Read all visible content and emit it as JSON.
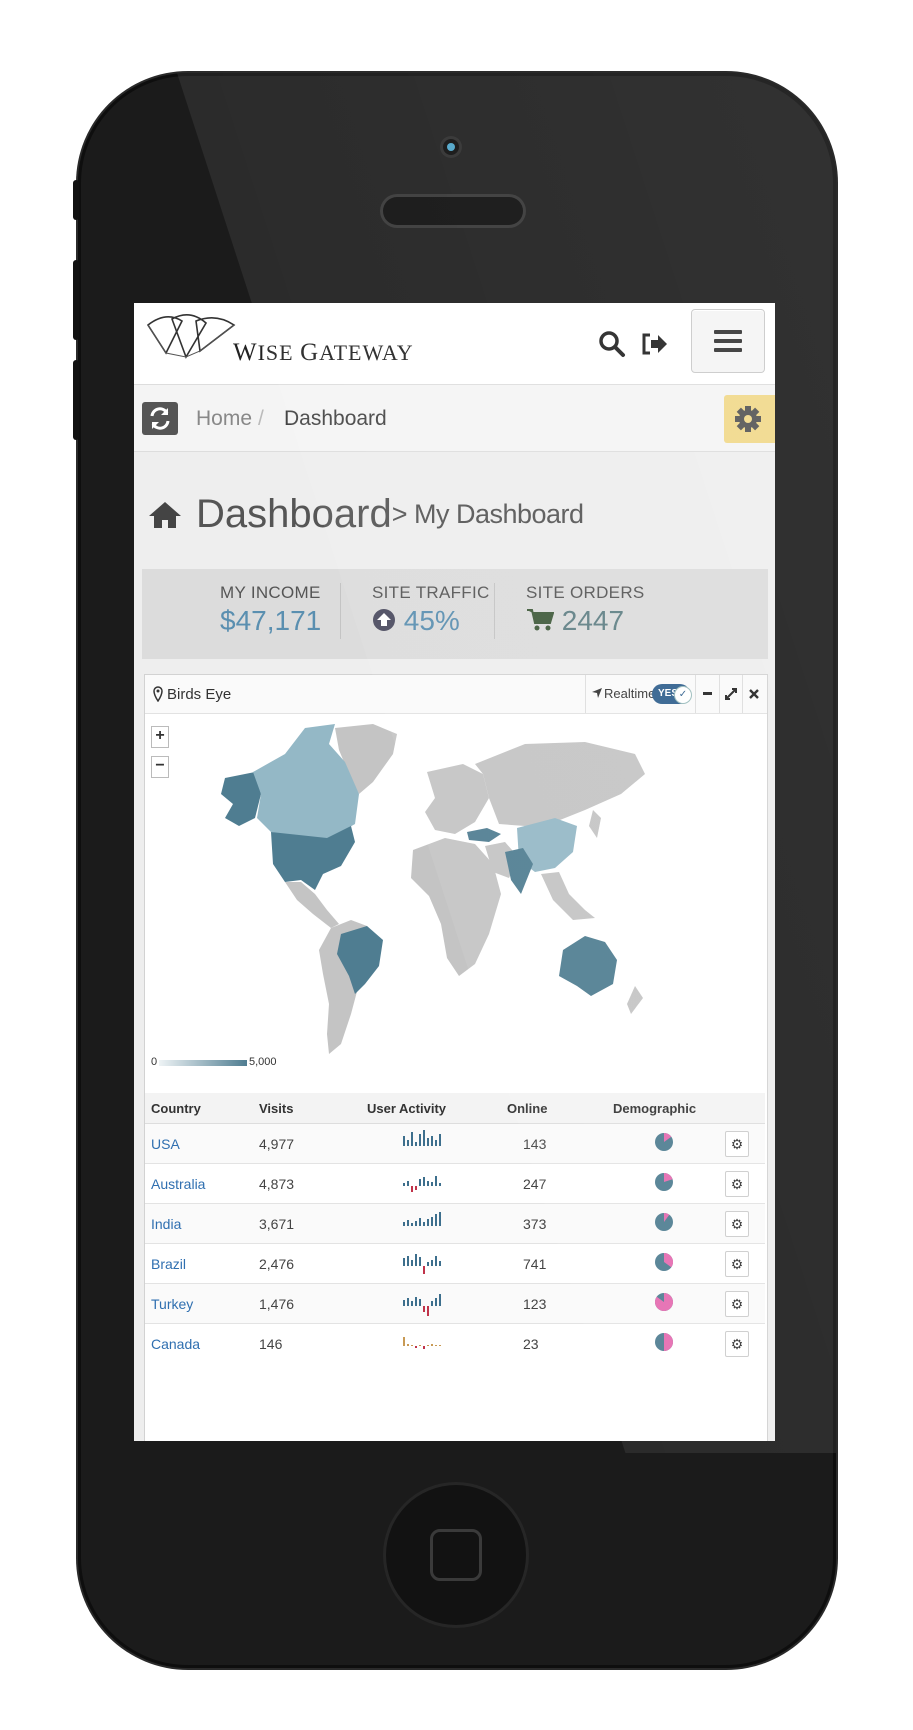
{
  "brand": {
    "name_cap1": "W",
    "name_rest1": "ISE ",
    "name_cap2": "G",
    "name_rest2": "ATEWAY"
  },
  "breadcrumb": {
    "home": "Home",
    "separator": "/",
    "current": "Dashboard"
  },
  "page": {
    "title": "Dashboard",
    "subtitle": "> My Dashboard"
  },
  "stats": [
    {
      "label": "MY INCOME",
      "value": "$47,171",
      "icon": ""
    },
    {
      "label": "SITE TRAFFIC",
      "value": "45%",
      "icon": "arrow-circle-up-icon"
    },
    {
      "label": "SITE ORDERS",
      "value": "2447",
      "icon": "cart-icon"
    }
  ],
  "widget": {
    "title": "Birds Eye",
    "realtime_label": "Realtime",
    "toggle_value": "YES",
    "legend_min": "0",
    "legend_max": "5,000"
  },
  "table": {
    "headers": [
      "Country",
      "Visits",
      "User Activity",
      "Online",
      "Demographic"
    ],
    "rows": [
      {
        "country": "USA",
        "visits": "4,977",
        "online": "143",
        "demo_pink": 0.15
      },
      {
        "country": "Australia",
        "visits": "4,873",
        "online": "247",
        "demo_pink": 0.2
      },
      {
        "country": "India",
        "visits": "3,671",
        "online": "373",
        "demo_pink": 0.1
      },
      {
        "country": "Brazil",
        "visits": "2,476",
        "online": "741",
        "demo_pink": 0.35
      },
      {
        "country": "Turkey",
        "visits": "1,476",
        "online": "123",
        "demo_pink": 0.85
      },
      {
        "country": "Canada",
        "visits": "146",
        "online": "23",
        "demo_pink": 0.5
      }
    ]
  },
  "colors": {
    "accent": "#5a8fb0",
    "map_dark": "#4f7d91",
    "map_light": "#94b8c6",
    "map_grey": "#c4c4c4",
    "pink": "#e56bb0",
    "gear_btn": "#f1d98a"
  }
}
